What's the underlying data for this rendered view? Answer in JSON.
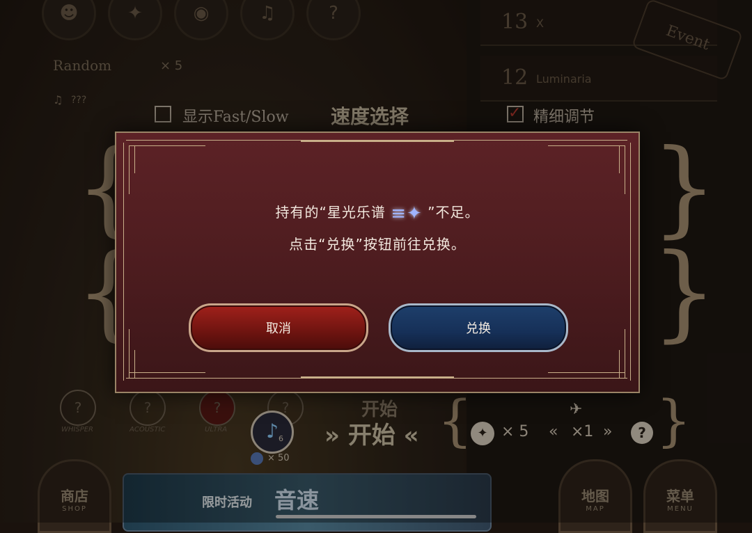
{
  "dialog": {
    "line1_pre": "持有的“星光乐谱",
    "line1_post": "”不足。",
    "line2": "点击“兑换”按钮前往兑换。",
    "cancel_label": "取消",
    "confirm_label": "兑换"
  },
  "background": {
    "random_label": "Random",
    "random_count": "× 5",
    "song_placeholder": "???",
    "show_fast_slow": "显示Fast/Slow",
    "speed_select": "速度选择",
    "fine_tune": "精细调节",
    "songs": [
      {
        "num": "13",
        "title": "X"
      },
      {
        "num": "12",
        "title": "Luminaria"
      }
    ],
    "event_badge": "Event",
    "difficulties": [
      "WHISPER",
      "ACOUSTIC",
      "ULTRA",
      ""
    ],
    "note_count": "6",
    "coin_count": "× 50",
    "start_small": "开始",
    "start_large": "开始",
    "ticket_count": "× 5",
    "multiplier": "×1",
    "help": "?",
    "limited_event": "限时活动",
    "speed_banner": "音速",
    "shop": "商店",
    "shop_en": "SHOP",
    "map": "地图",
    "map_en": "MAP",
    "menu": "菜单",
    "menu_en": "MENU"
  },
  "colors": {
    "dialog_bg": "#4f1d20",
    "cancel": "#8a1a15",
    "confirm": "#163058",
    "frame": "#c9b08a"
  }
}
